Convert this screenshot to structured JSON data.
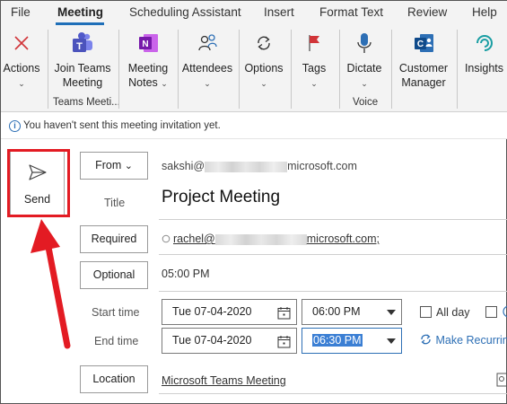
{
  "menu": {
    "file": "File",
    "meeting": "Meeting",
    "scheduling": "Scheduling Assistant",
    "insert": "Insert",
    "format": "Format Text",
    "review": "Review",
    "help": "Help"
  },
  "ribbon": {
    "actions": "Actions",
    "join_teams_1": "Join Teams",
    "join_teams_2": "Meeting",
    "group_teams": "Teams Meeti...",
    "meeting_notes_1": "Meeting",
    "meeting_notes_2": "Notes",
    "attendees": "Attendees",
    "options": "Options",
    "tags": "Tags",
    "dictate": "Dictate",
    "group_voice": "Voice",
    "customer_manager_1": "Customer",
    "customer_manager_2": "Manager",
    "insights": "Insights"
  },
  "info": {
    "message": "You haven't sent this meeting invitation yet."
  },
  "form": {
    "send": "Send",
    "from_button": "From",
    "from_user": "sakshi@",
    "from_domain": "microsoft.com",
    "title_label": "Title",
    "title_value": "Project Meeting",
    "required_button": "Required",
    "required_user": "rachel@",
    "required_domain": "microsoft.com;",
    "optional_button": "Optional",
    "optional_value": "05:00 PM",
    "start_label": "Start time",
    "start_date": "Tue 07-04-2020",
    "start_time": "06:00 PM",
    "end_label": "End time",
    "end_date": "Tue 07-04-2020",
    "end_time": "06:30 PM",
    "all_day": "All day",
    "make_recurring": "Make Recurring",
    "location_button": "Location",
    "location_value": "Microsoft Teams Meeting"
  },
  "colors": {
    "accent": "#1f6fb8",
    "highlight": "#e31b23",
    "selection": "#3b7fd4"
  }
}
